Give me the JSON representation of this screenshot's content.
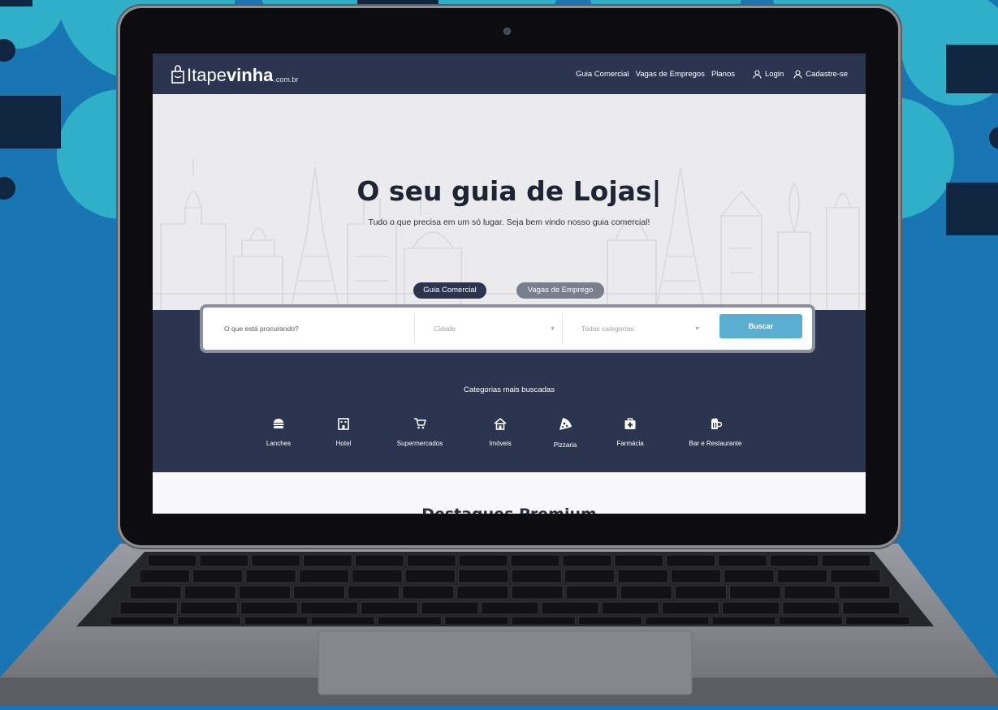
{
  "colors": {
    "background": "#1a76b2",
    "navbar": "#2c3550",
    "accent_button": "#5aaed2",
    "tab_active": "#2c3550",
    "tab_inactive": "#7a7f8e"
  },
  "site": {
    "logo_part1": "Itape",
    "logo_part2": "vinha",
    "logo_part3": ".com.br"
  },
  "nav": {
    "links": [
      "Guia Comercial",
      "Vagas de Empregos",
      "Planos"
    ],
    "login": "Login",
    "signup": "Cadastre-se"
  },
  "hero": {
    "title": "O seu guia de Lojas|",
    "subtitle": "Tudo o que precisa em um só lugar. Seja bem vindo nosso guia comercial!"
  },
  "tabs": {
    "active": "Guia Comercial",
    "inactive": "Vagas de Emprego"
  },
  "search": {
    "query_placeholder": "O que está procurando?",
    "city_placeholder": "Cidade",
    "category_placeholder": "Todas categorias",
    "button": "Buscar"
  },
  "categories": {
    "title": "Categorias mais buscadas",
    "items": [
      {
        "label": "Lanches",
        "icon": "burger-icon"
      },
      {
        "label": "Hotel",
        "icon": "hotel-icon"
      },
      {
        "label": "Supermercados",
        "icon": "cart-icon"
      },
      {
        "label": "Imóveis",
        "icon": "house-icon"
      },
      {
        "label": "Pizzaria",
        "icon": "pizza-icon"
      },
      {
        "label": "Farmácia",
        "icon": "medkit-icon"
      },
      {
        "label": "Bar e Restaurante",
        "icon": "beer-icon"
      }
    ]
  },
  "premium": {
    "heading": "Destaques Premium"
  }
}
